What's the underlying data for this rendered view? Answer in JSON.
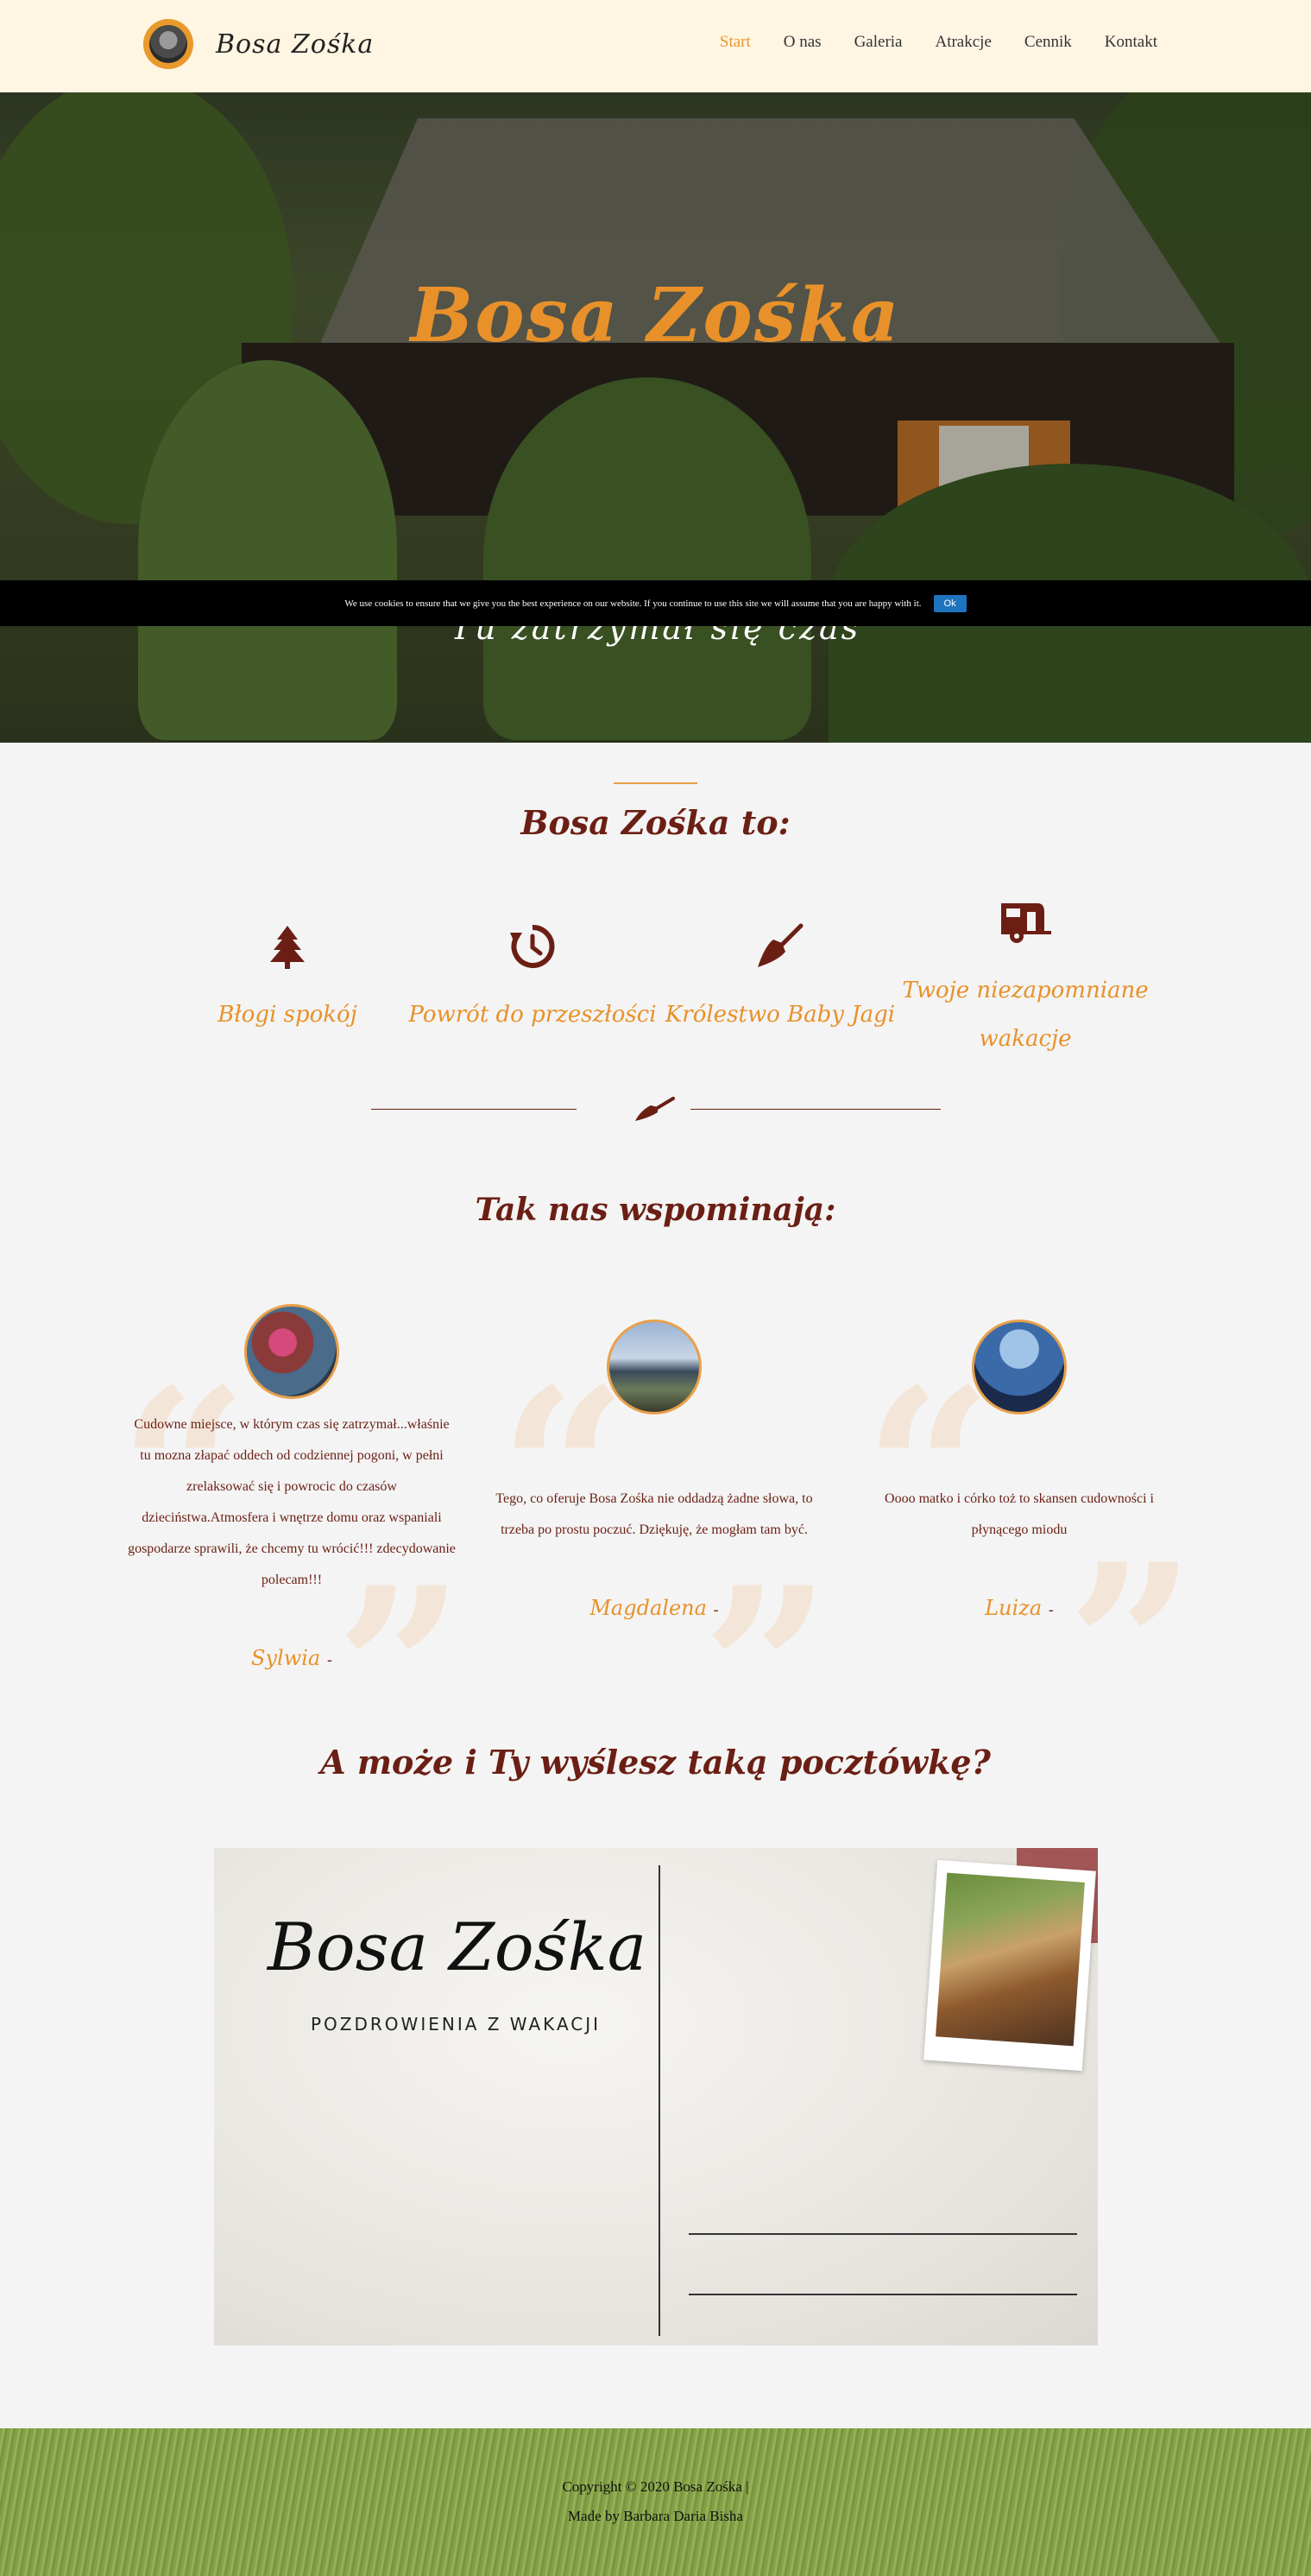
{
  "nav": {
    "brand": "Bosa Zośka",
    "items": [
      {
        "label": "Start",
        "active": true
      },
      {
        "label": "O nas",
        "active": false
      },
      {
        "label": "Galeria",
        "active": false
      },
      {
        "label": "Atrakcje",
        "active": false
      },
      {
        "label": "Cennik",
        "active": false
      },
      {
        "label": "Kontakt",
        "active": false
      }
    ]
  },
  "hero": {
    "title": "Bosa Zośka",
    "subtitle": "Tu zatrzymał się czas"
  },
  "cookie": {
    "text": "We use cookies to ensure that we give you the best experience on our website. If you continue to use this site we will assume that you are happy with it.",
    "button": "Ok"
  },
  "about": {
    "title": "Bosa Zośka to:",
    "features": [
      {
        "icon": "tree-icon",
        "label": "Błogi spokój"
      },
      {
        "icon": "history-icon",
        "label": "Powrót do przeszłości"
      },
      {
        "icon": "broom-icon",
        "label": "Królestwo Baby Jagi"
      },
      {
        "icon": "caravan-icon",
        "label": "Twoje niezapomniane wakacje"
      }
    ]
  },
  "testimonials": {
    "title": "Tak nas wspominają:",
    "items": [
      {
        "text": "Cudowne miejsce, w którym czas się zatrzymał...właśnie tu mozna złapać oddech od codziennej pogoni, w pełni zrelaksować się i powrocic do czasów dzieciństwa.Atmosfera i wnętrze domu oraz wspaniali gospodarze sprawili, że chcemy tu wrócić!!! zdecydowanie polecam!!!",
        "name": "Sylwia"
      },
      {
        "text": "Tego, co oferuje Bosa Zośka nie oddadzą żadne słowa, to trzeba po prostu poczuć. Dziękuję, że mogłam tam być.",
        "name": "Magdalena"
      },
      {
        "text": "Oooo matko i córko toż to skansen cudowności i płynącego miodu",
        "name": "Luiza"
      }
    ],
    "dash": "-"
  },
  "postcard": {
    "title": "A może i Ty wyślesz taką pocztówkę?",
    "card_title": "Bosa Zośka",
    "card_subtitle": "POZDROWIENIA Z WAKACJI"
  },
  "footer": {
    "copyright": "Copyright © 2020 Bosa Zośka |",
    "made_by": "Made by Barbara Daria Bisha"
  },
  "colors": {
    "accent": "#e8912a",
    "maroon": "#6b1f14",
    "nav_bg": "#fff5e3",
    "cookie_button": "#1e73be"
  }
}
